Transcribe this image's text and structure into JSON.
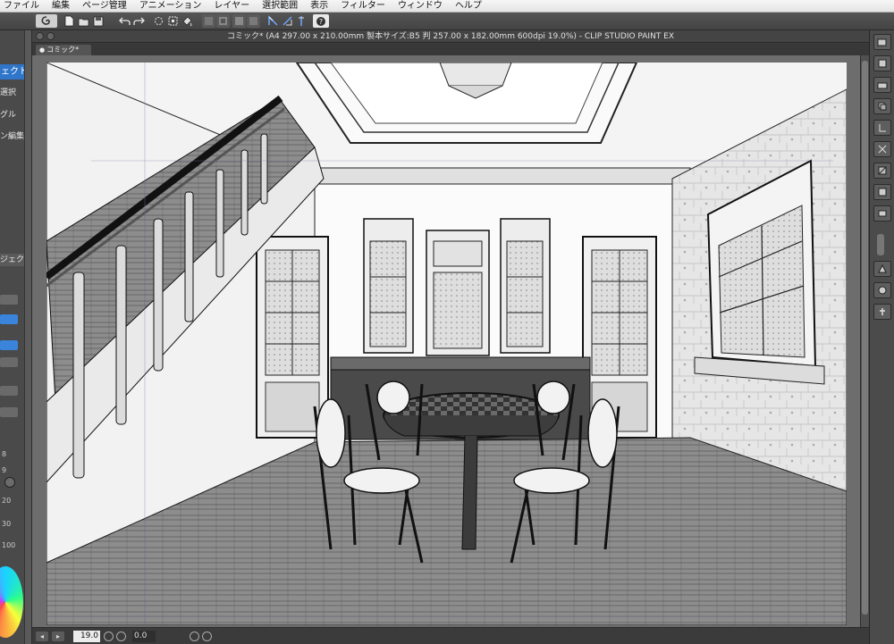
{
  "menu": {
    "items": [
      "ファイル",
      "編集",
      "ページ管理",
      "アニメーション",
      "レイヤー",
      "選択範囲",
      "表示",
      "フィルター",
      "ウィンドウ",
      "ヘルプ"
    ]
  },
  "window": {
    "title": "コミック* (A4 297.00 x 210.00mm 製本サイズ:B5 判 257.00 x 182.00mm 600dpi 19.0%)  - CLIP STUDIO PAINT EX"
  },
  "document_tab": {
    "label": "コミック*"
  },
  "left_panel": {
    "labels": [
      "ェクト",
      "選択",
      "グル",
      "ン編集",
      "ジェクト"
    ],
    "size_labels": [
      "8",
      "9",
      "20",
      "30",
      "100"
    ]
  },
  "status": {
    "zoom": "19.0",
    "angle": "0.0"
  },
  "colors": {
    "accent": "#2f75c9",
    "chrome": "#4a4a4a",
    "canvas_bg": "#6d6d6d"
  },
  "icons": {
    "command_bar": [
      "clip-studio-logo-icon",
      "new-file-icon",
      "open-file-icon",
      "save-icon",
      "undo-icon",
      "redo-icon",
      "clear-icon",
      "transform-icon",
      "fill-icon",
      "select-icon",
      "selection-invert-icon",
      "ruler-icon",
      "snap-icon",
      "snap-special-icon",
      "help-icon"
    ],
    "right_panel": [
      "layer-icon",
      "layer-new-icon",
      "layer-folder-icon",
      "layer-copy-icon",
      "layer-merge-icon",
      "layer-delete-icon",
      "layer-mask-icon",
      "layer-lock-icon",
      "layer-clip-icon",
      "layer-ref-icon",
      "layer-property-icon",
      "layer-search-icon",
      "layer-move-icon"
    ]
  }
}
